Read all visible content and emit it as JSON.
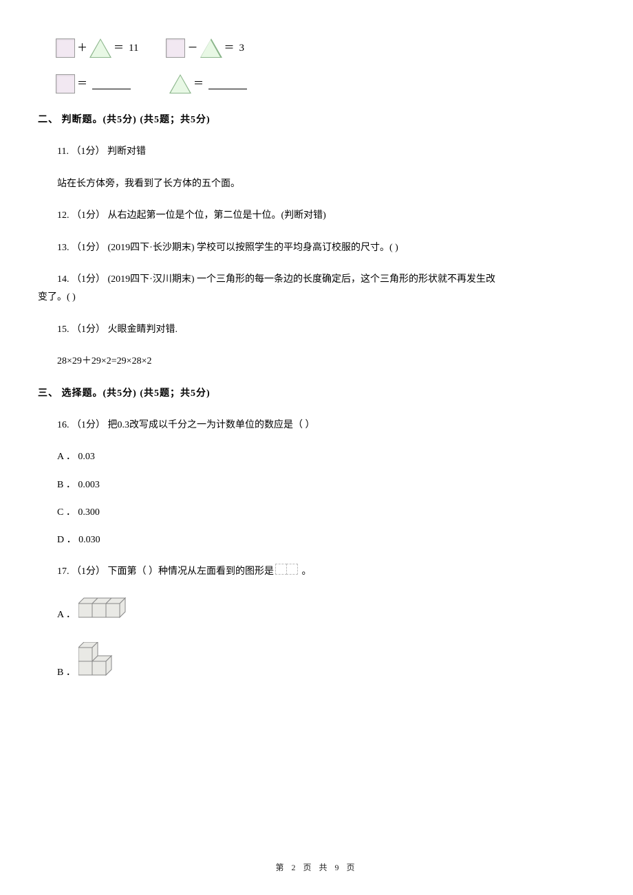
{
  "shape_eq": {
    "plus_op": "＋",
    "minus_op": "－",
    "eq": "＝",
    "sum_val": "11",
    "diff_val": "3",
    "eq_only": "＝"
  },
  "section2": {
    "title": "二、 判断题。(共5分)  (共5题；共5分)"
  },
  "q11": {
    "line1": "11.   （1分） 判断对错",
    "line2": "站在长方体旁，我看到了长方体的五个面。"
  },
  "q12": {
    "text": "12.   （1分） 从右边起第一位是个位，第二位是十位。(判断对错)"
  },
  "q13": {
    "text": "13.   （1分） (2019四下·长沙期末) 学校可以按照学生的平均身高订校服的尺寸。(      )"
  },
  "q14": {
    "line1": "14.   （1分） (2019四下·汉川期末) 一个三角形的每一条边的长度确定后，这个三角形的形状就不再发生改",
    "line2": "变了。(      )"
  },
  "q15": {
    "line1": "15.   （1分） 火眼金睛判对错.",
    "expr": "28×29＋29×2=29×28×2"
  },
  "section3": {
    "title": "三、 选择题。(共5分)  (共5题；共5分)"
  },
  "q16": {
    "stem": "16.   （1分） 把0.3改写成以千分之一为计数单位的数应是（       ）",
    "a": "A ．  0.03",
    "b": "B ．  0.003",
    "c": "C ．  0.300",
    "d": "D ．  0.030"
  },
  "q17": {
    "before": "17.   （1分） 下面第（       ）种情况从左面看到的图形是",
    "after": "。",
    "a": "A ．",
    "b": "B ．"
  },
  "footer": "第  2  页  共  9  页"
}
